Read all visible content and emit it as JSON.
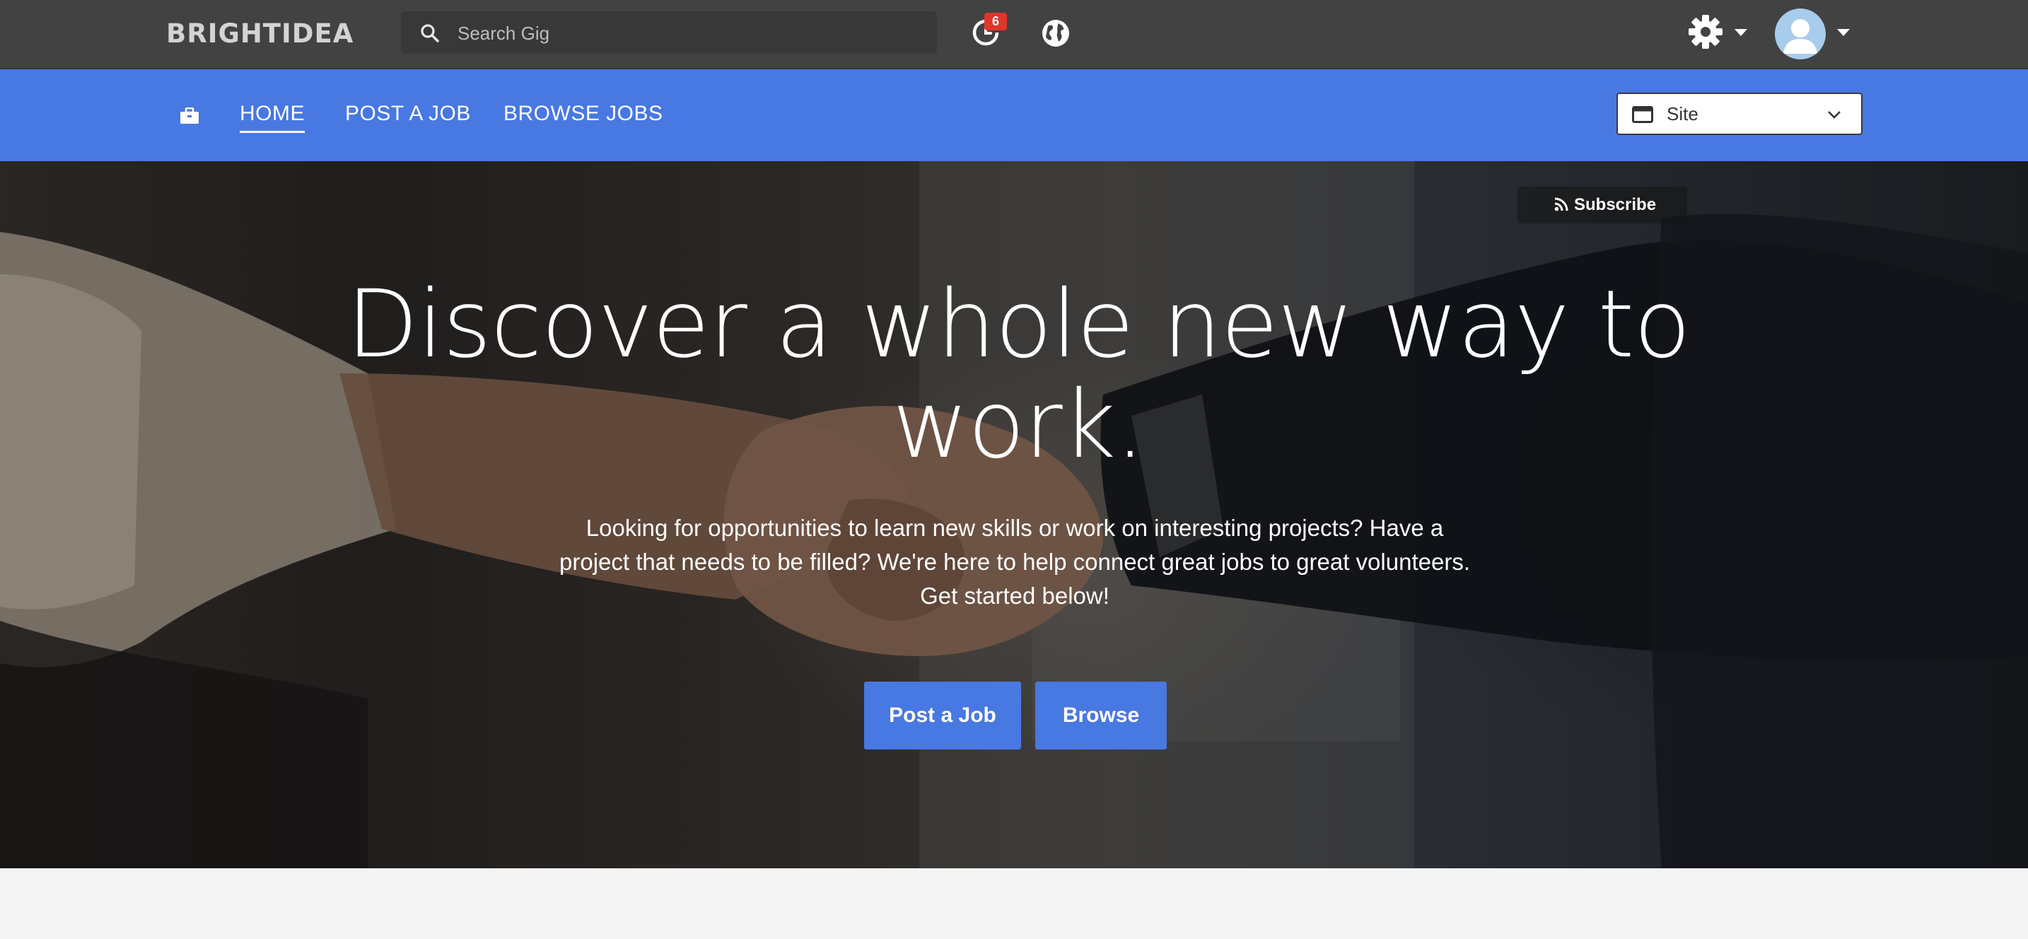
{
  "header": {
    "logo_text": "BRIGHTIDEA",
    "search": {
      "placeholder": "Search Gig",
      "value": ""
    },
    "notifications": {
      "count": "6"
    },
    "icons": [
      "search-icon",
      "notification-clock-icon",
      "globe-icon",
      "gear-icon",
      "user-avatar",
      "caret-down-icon"
    ]
  },
  "nav": {
    "items": [
      {
        "label": "HOME",
        "active": true
      },
      {
        "label": "POST A JOB",
        "active": false
      },
      {
        "label": "BROWSE JOBS",
        "active": false
      }
    ],
    "site_selector": {
      "selected": "Site"
    }
  },
  "hero": {
    "subscribe_label": "Subscribe",
    "headline": "Discover a whole new way to work.",
    "description": "Looking for opportunities to learn new skills or work on interesting projects? Have a project that needs to be filled? We're here to help connect great jobs to great volunteers. Get started below!",
    "buttons": {
      "post_job": "Post a Job",
      "browse": "Browse"
    }
  },
  "colors": {
    "topbar": "#424242",
    "nav": "#4878e1",
    "button": "#4878e1",
    "badge": "#e0352b"
  }
}
